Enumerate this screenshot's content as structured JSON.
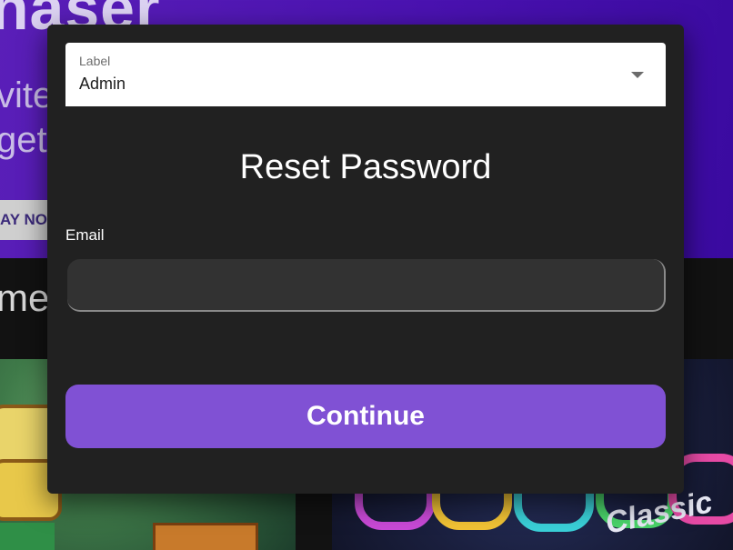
{
  "background": {
    "hero": {
      "title_fragment": "haser",
      "line1_fragment": "vite",
      "line2_fragment": "get",
      "play_button_fragment": "AY NOV"
    },
    "games_heading_fragment": "mes",
    "right_thumb_text": "Classic"
  },
  "modal": {
    "select": {
      "label": "Label",
      "value": "Admin"
    },
    "title": "Reset Password",
    "email": {
      "label": "Email",
      "value": "",
      "placeholder": ""
    },
    "continue_label": "Continue"
  },
  "colors": {
    "modal_background": "#212121",
    "accent": "#8051d4",
    "hero_gradient_start": "#5a1fb8",
    "hero_gradient_end": "#3a0aa0"
  }
}
